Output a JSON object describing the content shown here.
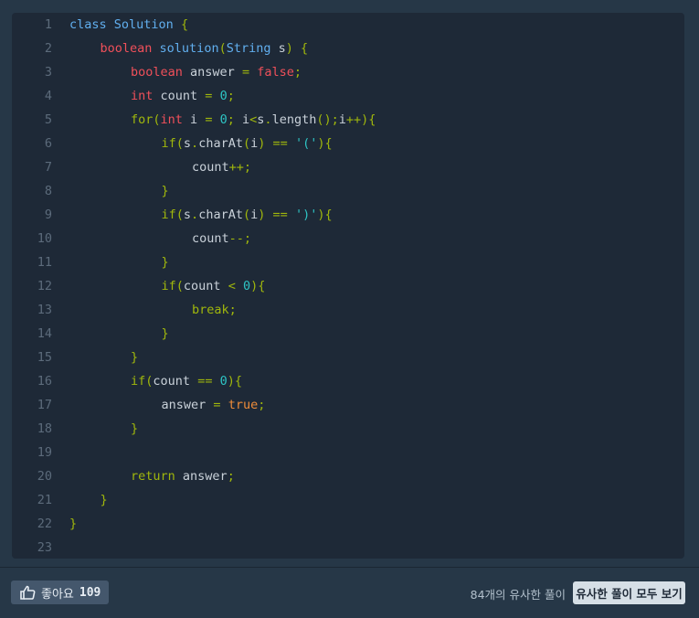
{
  "colors": {
    "default": "#c9d1d9",
    "keyword": "#f0505a",
    "blue": "#61afef",
    "olive": "#a0b70c",
    "cyan": "#2ec4c4",
    "orange": "#ef8c39",
    "linenum": "#5c6b7b"
  },
  "code_lines": [
    {
      "n": "1",
      "indent": 0,
      "tokens": [
        {
          "t": "class ",
          "c": "blue"
        },
        {
          "t": "Solution",
          "c": "blue"
        },
        {
          "t": " {",
          "c": "olive"
        }
      ]
    },
    {
      "n": "2",
      "indent": 1,
      "tokens": [
        {
          "t": "boolean",
          "c": "keyword"
        },
        {
          "t": " ",
          "c": "default"
        },
        {
          "t": "solution",
          "c": "blue"
        },
        {
          "t": "(",
          "c": "olive"
        },
        {
          "t": "String",
          "c": "blue"
        },
        {
          "t": " s",
          "c": "default"
        },
        {
          "t": ")",
          "c": "olive"
        },
        {
          "t": " {",
          "c": "olive"
        }
      ]
    },
    {
      "n": "3",
      "indent": 2,
      "tokens": [
        {
          "t": "boolean",
          "c": "keyword"
        },
        {
          "t": " answer ",
          "c": "default"
        },
        {
          "t": "=",
          "c": "olive"
        },
        {
          "t": " ",
          "c": "default"
        },
        {
          "t": "false",
          "c": "keyword"
        },
        {
          "t": ";",
          "c": "olive"
        }
      ]
    },
    {
      "n": "4",
      "indent": 2,
      "tokens": [
        {
          "t": "int",
          "c": "keyword"
        },
        {
          "t": " count ",
          "c": "default"
        },
        {
          "t": "=",
          "c": "olive"
        },
        {
          "t": " ",
          "c": "default"
        },
        {
          "t": "0",
          "c": "cyan"
        },
        {
          "t": ";",
          "c": "olive"
        }
      ]
    },
    {
      "n": "5",
      "indent": 2,
      "tokens": [
        {
          "t": "for",
          "c": "olive"
        },
        {
          "t": "(",
          "c": "olive"
        },
        {
          "t": "int",
          "c": "keyword"
        },
        {
          "t": " i ",
          "c": "default"
        },
        {
          "t": "=",
          "c": "olive"
        },
        {
          "t": " ",
          "c": "default"
        },
        {
          "t": "0",
          "c": "cyan"
        },
        {
          "t": ";",
          "c": "olive"
        },
        {
          "t": " i",
          "c": "default"
        },
        {
          "t": "<",
          "c": "olive"
        },
        {
          "t": "s",
          "c": "default"
        },
        {
          "t": ".",
          "c": "olive"
        },
        {
          "t": "length",
          "c": "default"
        },
        {
          "t": "()",
          "c": "olive"
        },
        {
          "t": ";",
          "c": "olive"
        },
        {
          "t": "i",
          "c": "default"
        },
        {
          "t": "++",
          "c": "olive"
        },
        {
          "t": "){",
          "c": "olive"
        }
      ]
    },
    {
      "n": "6",
      "indent": 3,
      "tokens": [
        {
          "t": "if",
          "c": "olive"
        },
        {
          "t": "(",
          "c": "olive"
        },
        {
          "t": "s",
          "c": "default"
        },
        {
          "t": ".",
          "c": "olive"
        },
        {
          "t": "charAt",
          "c": "default"
        },
        {
          "t": "(",
          "c": "olive"
        },
        {
          "t": "i",
          "c": "default"
        },
        {
          "t": ")",
          "c": "olive"
        },
        {
          "t": " ",
          "c": "default"
        },
        {
          "t": "==",
          "c": "olive"
        },
        {
          "t": " ",
          "c": "default"
        },
        {
          "t": "'('",
          "c": "cyan"
        },
        {
          "t": "){",
          "c": "olive"
        }
      ]
    },
    {
      "n": "7",
      "indent": 4,
      "tokens": [
        {
          "t": "count",
          "c": "default"
        },
        {
          "t": "++;",
          "c": "olive"
        }
      ]
    },
    {
      "n": "8",
      "indent": 3,
      "tokens": [
        {
          "t": "}",
          "c": "olive"
        }
      ]
    },
    {
      "n": "9",
      "indent": 3,
      "tokens": [
        {
          "t": "if",
          "c": "olive"
        },
        {
          "t": "(",
          "c": "olive"
        },
        {
          "t": "s",
          "c": "default"
        },
        {
          "t": ".",
          "c": "olive"
        },
        {
          "t": "charAt",
          "c": "default"
        },
        {
          "t": "(",
          "c": "olive"
        },
        {
          "t": "i",
          "c": "default"
        },
        {
          "t": ")",
          "c": "olive"
        },
        {
          "t": " ",
          "c": "default"
        },
        {
          "t": "==",
          "c": "olive"
        },
        {
          "t": " ",
          "c": "default"
        },
        {
          "t": "')'",
          "c": "cyan"
        },
        {
          "t": "){",
          "c": "olive"
        }
      ]
    },
    {
      "n": "10",
      "indent": 4,
      "tokens": [
        {
          "t": "count",
          "c": "default"
        },
        {
          "t": "--;",
          "c": "olive"
        }
      ]
    },
    {
      "n": "11",
      "indent": 3,
      "tokens": [
        {
          "t": "}",
          "c": "olive"
        }
      ]
    },
    {
      "n": "12",
      "indent": 3,
      "tokens": [
        {
          "t": "if",
          "c": "olive"
        },
        {
          "t": "(",
          "c": "olive"
        },
        {
          "t": "count ",
          "c": "default"
        },
        {
          "t": "<",
          "c": "olive"
        },
        {
          "t": " ",
          "c": "default"
        },
        {
          "t": "0",
          "c": "cyan"
        },
        {
          "t": "){",
          "c": "olive"
        }
      ]
    },
    {
      "n": "13",
      "indent": 4,
      "tokens": [
        {
          "t": "break",
          "c": "olive"
        },
        {
          "t": ";",
          "c": "olive"
        }
      ]
    },
    {
      "n": "14",
      "indent": 3,
      "tokens": [
        {
          "t": "}",
          "c": "olive"
        }
      ]
    },
    {
      "n": "15",
      "indent": 2,
      "tokens": [
        {
          "t": "}",
          "c": "olive"
        }
      ]
    },
    {
      "n": "16",
      "indent": 2,
      "tokens": [
        {
          "t": "if",
          "c": "olive"
        },
        {
          "t": "(",
          "c": "olive"
        },
        {
          "t": "count ",
          "c": "default"
        },
        {
          "t": "==",
          "c": "olive"
        },
        {
          "t": " ",
          "c": "default"
        },
        {
          "t": "0",
          "c": "cyan"
        },
        {
          "t": "){",
          "c": "olive"
        }
      ]
    },
    {
      "n": "17",
      "indent": 3,
      "tokens": [
        {
          "t": "answer ",
          "c": "default"
        },
        {
          "t": "=",
          "c": "olive"
        },
        {
          "t": " ",
          "c": "default"
        },
        {
          "t": "true",
          "c": "orange"
        },
        {
          "t": ";",
          "c": "olive"
        }
      ]
    },
    {
      "n": "18",
      "indent": 2,
      "tokens": [
        {
          "t": "}",
          "c": "olive"
        }
      ]
    },
    {
      "n": "19",
      "indent": 0,
      "tokens": []
    },
    {
      "n": "20",
      "indent": 2,
      "tokens": [
        {
          "t": "return",
          "c": "olive"
        },
        {
          "t": " answer",
          "c": "default"
        },
        {
          "t": ";",
          "c": "olive"
        }
      ]
    },
    {
      "n": "21",
      "indent": 1,
      "tokens": [
        {
          "t": "}",
          "c": "olive"
        }
      ]
    },
    {
      "n": "22",
      "indent": 0,
      "tokens": [
        {
          "t": "}",
          "c": "olive"
        }
      ]
    },
    {
      "n": "23",
      "indent": 0,
      "tokens": []
    }
  ],
  "footer": {
    "like_icon": "thumbs-up-icon",
    "like_label": "좋아요",
    "like_count": "109",
    "similar_count_text": "84개의 유사한 풀이",
    "similar_button_label": "유사한 풀이 모두 보기"
  }
}
